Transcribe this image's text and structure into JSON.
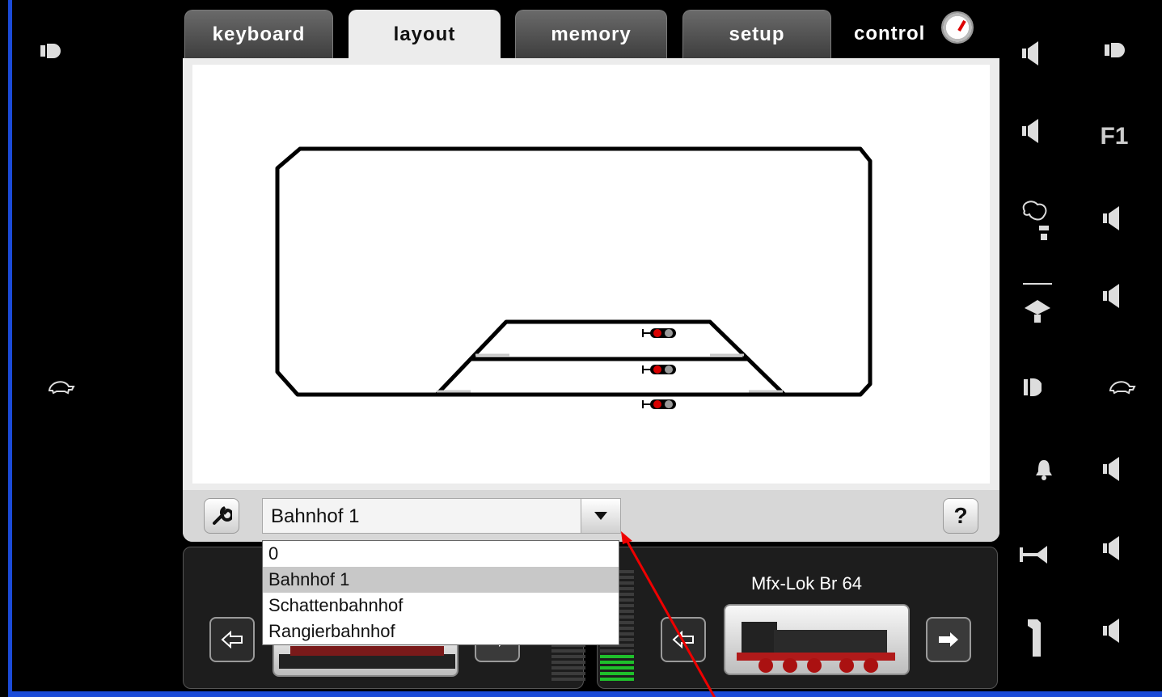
{
  "tabs": [
    {
      "label": "keyboard"
    },
    {
      "label": "layout"
    },
    {
      "label": "memory"
    },
    {
      "label": "setup"
    },
    {
      "label": "control"
    }
  ],
  "active_tab": "layout",
  "layout_selector": {
    "value": "Bahnhof 1",
    "options": [
      "0",
      "Bahnhof 1",
      "Schattenbahnhof",
      "Rangierbahnhof"
    ],
    "selected_index": 1
  },
  "toolbar": {
    "help_label": "?"
  },
  "right_panel": {
    "loco_name": "Mfx-Lok Br 64"
  },
  "right_icons": {
    "f1_label": "F1"
  },
  "icons": {
    "light": "light-icon",
    "turtle": "turtle-icon",
    "speaker": "speaker-icon",
    "smoke": "smoke-icon",
    "crane": "crane-icon",
    "bell": "bell-icon",
    "horn": "horn-icon",
    "door": "door-icon"
  },
  "colors": {
    "accent_blue": "#1b4bd8",
    "signal_red": "#d80000",
    "meter_green": "#1fbf2b"
  }
}
